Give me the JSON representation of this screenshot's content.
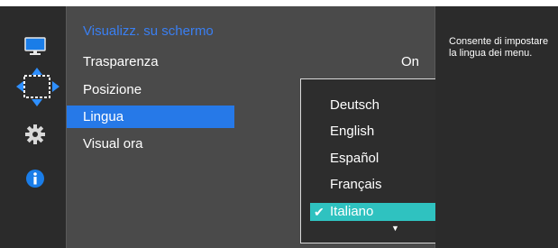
{
  "osd": {
    "menu_title": "Visualizz. su schermo",
    "items": [
      {
        "label": "Trasparenza",
        "value": "On"
      },
      {
        "label": "Posizione"
      },
      {
        "label": "Lingua"
      },
      {
        "label": "Visual ora"
      }
    ],
    "language_dropdown": {
      "options": [
        "Deutsch",
        "English",
        "Español",
        "Français",
        "Italiano"
      ],
      "selected": "Italiano",
      "check_mark": "✔",
      "more_indicator": "▼"
    },
    "help_text": "Consente di impostare la lingua dei menu."
  },
  "sidebar_icons": [
    "monitor-icon",
    "move-arrows-icon",
    "gear-icon",
    "info-icon"
  ],
  "colors": {
    "accent": "#2679e8",
    "title": "#3a7ff2",
    "selected_option": "#2fc2c0",
    "icon_blue": "#1a7de8"
  }
}
